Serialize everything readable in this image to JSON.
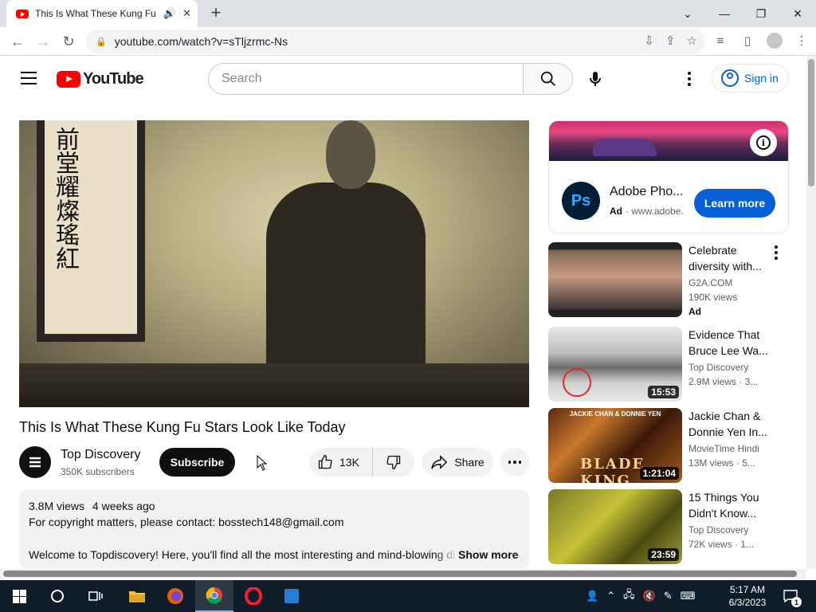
{
  "browser": {
    "tab_title": "This Is What These Kung Fu",
    "new_tab": "+",
    "url": "youtube.com/watch?v=sTljzrmc-Ns"
  },
  "youtube": {
    "logo_text": "YouTube",
    "search_placeholder": "Search",
    "signin_label": "Sign in"
  },
  "video": {
    "title": "This Is What These Kung Fu Stars Look Like Today",
    "calligraphy": "前堂耀燦瑤紅",
    "channel": "Top Discovery",
    "subscribers": "350K subscribers",
    "subscribe_label": "Subscribe",
    "likes": "13K",
    "share_label": "Share"
  },
  "description": {
    "views": "3.8M views",
    "age": "4 weeks ago",
    "line1": "For copyright matters, please contact: bosstech148@gmail.com",
    "line3": "Welcome to Topdiscovery! Here, you'll find all the most interesting and mind-blowing di",
    "show_more": "Show more"
  },
  "ad": {
    "logo": "Ps",
    "title": "Adobe Pho...",
    "badge": "Ad",
    "domain": "· www.adobe.",
    "cta": "Learn more"
  },
  "recommendations": [
    {
      "title": "Celebrate diversity with...",
      "channel": "G2A.COM",
      "views": "190K views",
      "badge": "Ad",
      "duration": ""
    },
    {
      "title": "Evidence That Bruce Lee Wa...",
      "channel": "Top Discovery",
      "views": "2.9M views · 3...",
      "duration": "15:53"
    },
    {
      "title": "Jackie Chan & Donnie Yen In...",
      "channel": "MovieTime Hindi",
      "views": "13M views · 5...",
      "duration": "1:21:04",
      "thumb_header": "JACKIE CHAN & DONNIE YEN",
      "thumb_text": "BLADE KING"
    },
    {
      "title": "15 Things You Didn't Know...",
      "channel": "Top Discovery",
      "views": "72K views · 1...",
      "duration": "23:59"
    }
  ],
  "taskbar": {
    "time": "5:17 AM",
    "date": "6/3/2023",
    "notifications": "1"
  }
}
